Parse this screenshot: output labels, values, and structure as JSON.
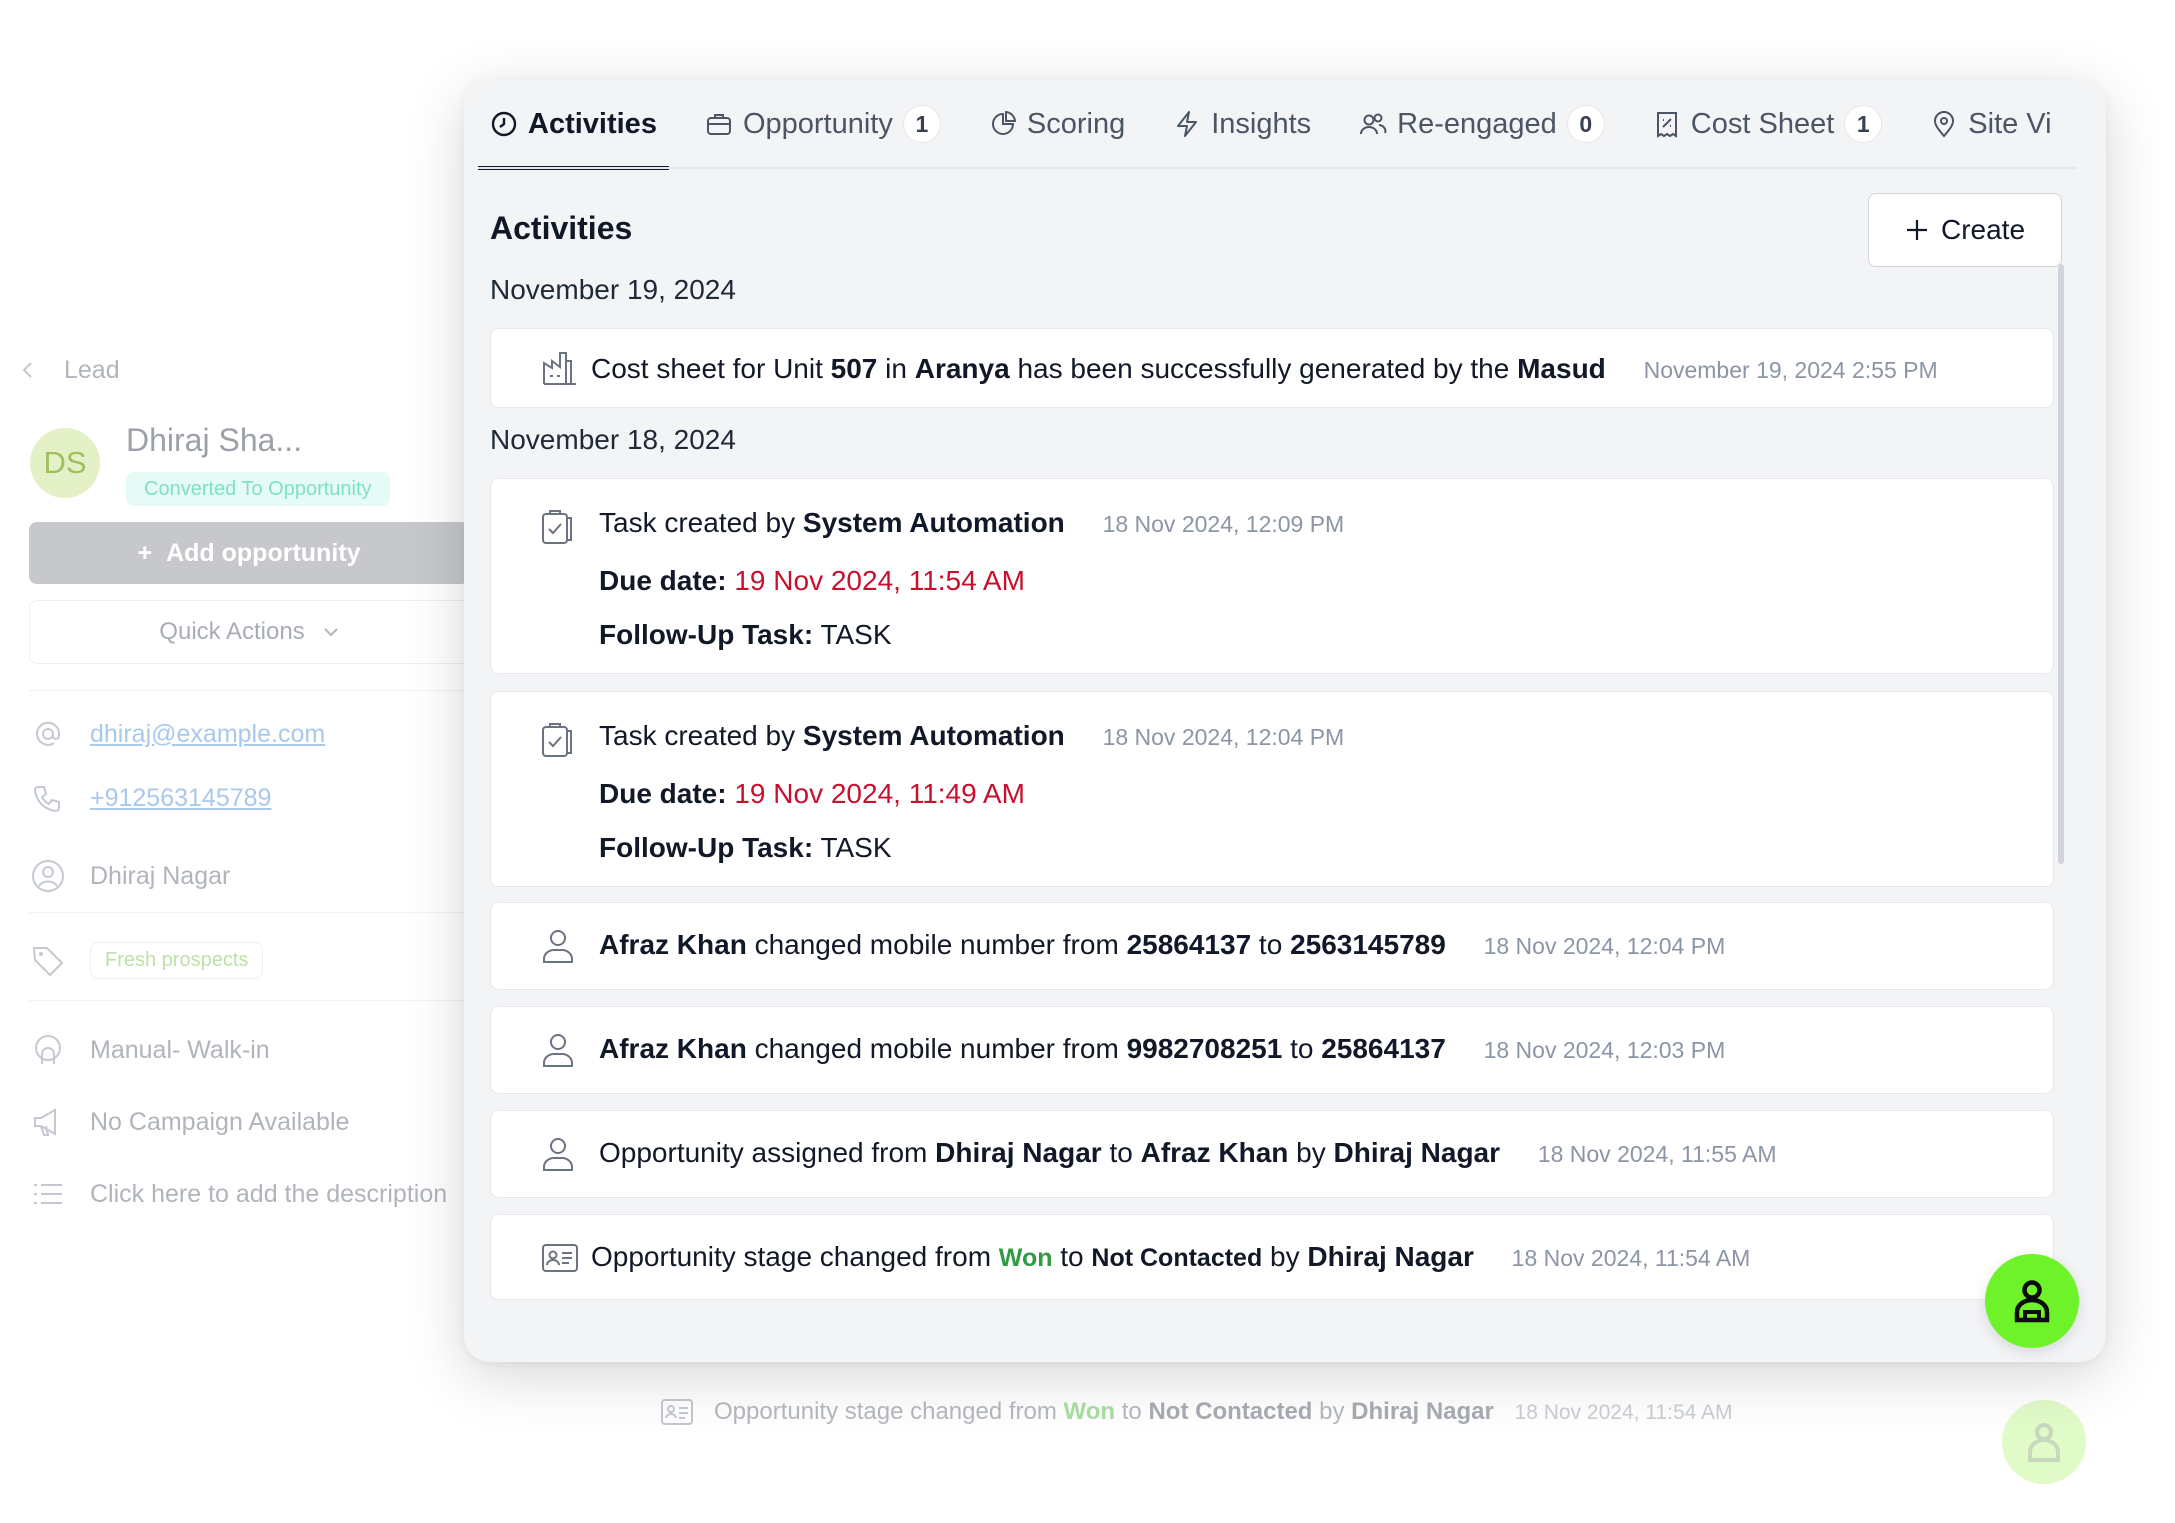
{
  "background": {
    "breadcrumb": "Lead",
    "avatar_initials": "DS",
    "lead_name": "Dhiraj  Sha...",
    "status": "Converted To Opportunity",
    "add_opportunity": "Add opportunity",
    "add_opportunity_plus": "+",
    "quick_actions": "Quick Actions",
    "email": "dhiraj@example.com",
    "phone": "+912563145789",
    "owner": "Dhiraj Nagar",
    "tag": "Fresh prospects",
    "source": "Manual- Walk-in",
    "campaign": "No Campaign Available",
    "description_placeholder": "Click here to add the description",
    "ghost_row": {
      "prefix": "Opportunity stage changed from",
      "from": "Won",
      "to_word": "to",
      "to": "Not Contacted",
      "by_word": "by",
      "actor": "Dhiraj Nagar",
      "time": "18 Nov 2024, 11:54 AM"
    }
  },
  "tabs": [
    {
      "label": "Activities",
      "icon": "clock-icon",
      "active": true
    },
    {
      "label": "Opportunity",
      "icon": "briefcase-icon",
      "badge": "1"
    },
    {
      "label": "Scoring",
      "icon": "pie-chart-icon"
    },
    {
      "label": "Insights",
      "icon": "lightning-icon"
    },
    {
      "label": "Re-engaged",
      "icon": "users-icon",
      "badge": "0"
    },
    {
      "label": "Cost Sheet",
      "icon": "receipt-icon",
      "badge": "1"
    },
    {
      "label": "Site Vi",
      "icon": "map-pin-icon"
    }
  ],
  "section_title": "Activities",
  "create_label": "Create",
  "dates": [
    "November 19, 2024",
    "November 18, 2024"
  ],
  "activities": {
    "cost_sheet": {
      "icon": "factory-icon",
      "p1": "Cost sheet for Unit",
      "unit": "507",
      "p2": "in",
      "project": "Aranya",
      "p3": "has been successfully generated by the",
      "actor": "Masud",
      "time": "November 19, 2024 2:55 PM"
    },
    "task1": {
      "icon": "clipboard-check-icon",
      "title_prefix": "Task created by",
      "actor": "System Automation",
      "time": "18 Nov 2024, 12:09 PM",
      "due_label": "Due date:",
      "due_value": "19 Nov 2024, 11:54 AM",
      "follow_label": "Follow-Up Task:",
      "follow_value": "TASK"
    },
    "task2": {
      "icon": "clipboard-check-icon",
      "title_prefix": "Task created by",
      "actor": "System Automation",
      "time": "18 Nov 2024, 12:04 PM",
      "due_label": "Due date:",
      "due_value": "19 Nov 2024, 11:49 AM",
      "follow_label": "Follow-Up Task:",
      "follow_value": "TASK"
    },
    "mobile1": {
      "icon": "user-icon",
      "actor": "Afraz Khan",
      "p1": "changed mobile number from",
      "from": "25864137",
      "to_word": "to",
      "to": "2563145789",
      "time": "18 Nov 2024, 12:04 PM"
    },
    "mobile2": {
      "icon": "user-icon",
      "actor": "Afraz Khan",
      "p1": "changed mobile number from",
      "from": "9982708251",
      "to_word": "to",
      "to": "25864137",
      "time": "18 Nov 2024, 12:03 PM"
    },
    "assigned": {
      "icon": "user-icon",
      "p1": "Opportunity assigned from",
      "from": "Dhiraj Nagar",
      "to_word": "to",
      "to": "Afraz Khan",
      "by_word": "by",
      "actor": "Dhiraj Nagar",
      "time": "18 Nov 2024, 11:55 AM"
    },
    "stage": {
      "icon": "id-card-icon",
      "p1": "Opportunity stage changed from",
      "from": "Won",
      "to_word": "to",
      "to": "Not Contacted",
      "by_word": "by",
      "actor": "Dhiraj Nagar",
      "time": "18 Nov 2024, 11:54 AM"
    }
  },
  "colors": {
    "accent_fab": "#6ef22a",
    "due_red": "#c8102e",
    "won_green": "#2e9c3f"
  }
}
